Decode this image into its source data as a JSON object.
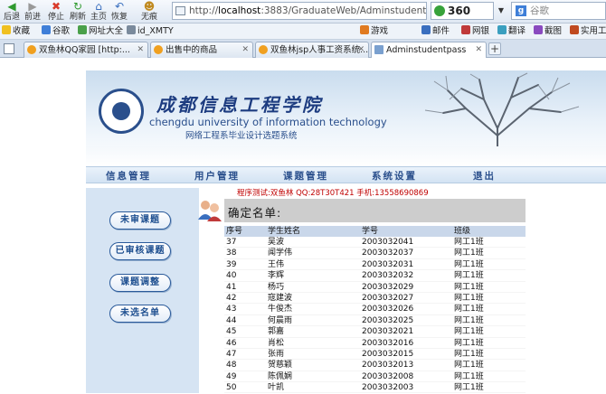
{
  "browser": {
    "nav": [
      {
        "label": "后退",
        "icon": "back-arrow-icon"
      },
      {
        "label": "前进",
        "icon": "forward-arrow-icon"
      },
      {
        "label": "停止",
        "icon": "stop-icon"
      },
      {
        "label": "刷新",
        "icon": "refresh-icon"
      },
      {
        "label": "主页",
        "icon": "home-icon"
      },
      {
        "label": "恢复",
        "icon": "restore-icon"
      },
      {
        "label": "无痕",
        "icon": "incognito-icon"
      }
    ],
    "url_prefix": "http://",
    "url_host": "localhost",
    "url_rest": ":3883/GraduateWeb/Adminstudentpass.aspx",
    "brand": "360",
    "search_placeholder": "谷歌",
    "bookmarks_left": [
      "收藏",
      "谷歌",
      "网址大全",
      "id_XMTY"
    ],
    "bookmarks_right": [
      "游戏",
      "邮件",
      "网银",
      "翻译",
      "截图",
      "实用工"
    ],
    "tabs": [
      {
        "title": "双鱼林QQ家园 [http:..."
      },
      {
        "title": "出售中的商品"
      },
      {
        "title": "双鱼林jsp人事工资系统..."
      },
      {
        "title": "Adminstudentpass"
      }
    ],
    "new_tab": "+"
  },
  "header": {
    "school_cn": "成都信息工程学院",
    "school_en": "chengdu university of information technology",
    "school_sub": "网络工程系毕业设计选题系统"
  },
  "menu": [
    "信息管理",
    "用户管理",
    "课题管理",
    "系统设置",
    "退出"
  ],
  "sidebar": [
    "未审课题",
    "已审核课题",
    "课题调整",
    "未选名单"
  ],
  "test_info": "程序测试:双鱼林 QQ:28T30T421 手机:13558690869",
  "confirm_title": "确定名单:",
  "table": {
    "headers": [
      "序号",
      "学生姓名",
      "学号",
      "班级"
    ],
    "rows": [
      [
        "37",
        "吴波",
        "2003032041",
        "网工1班"
      ],
      [
        "38",
        "闻学伟",
        "2003032037",
        "网工1班"
      ],
      [
        "39",
        "王伟",
        "2003032031",
        "网工1班"
      ],
      [
        "40",
        "李辉",
        "2003032032",
        "网工1班"
      ],
      [
        "41",
        "杨巧",
        "2003032029",
        "网工1班"
      ],
      [
        "42",
        "寇建波",
        "2003032027",
        "网工1班"
      ],
      [
        "43",
        "牛俊杰",
        "2003032026",
        "网工1班"
      ],
      [
        "44",
        "何晨雨",
        "2003032025",
        "网工1班"
      ],
      [
        "45",
        "郭嘉",
        "2003032021",
        "网工1班"
      ],
      [
        "46",
        "肖松",
        "2003032016",
        "网工1班"
      ],
      [
        "47",
        "张雨",
        "2003032015",
        "网工1班"
      ],
      [
        "48",
        "贺慈颖",
        "2003032013",
        "网工1班"
      ],
      [
        "49",
        "陈佩娴",
        "2003032008",
        "网工1班"
      ],
      [
        "50",
        "叶凯",
        "2003032003",
        "网工1班"
      ]
    ]
  },
  "colors": {
    "menu_text": "#2a4f8c",
    "test_info": "#c00000",
    "table_header_bg": "#c9d7ea",
    "sidebar_bg": "#d6e4f3"
  }
}
